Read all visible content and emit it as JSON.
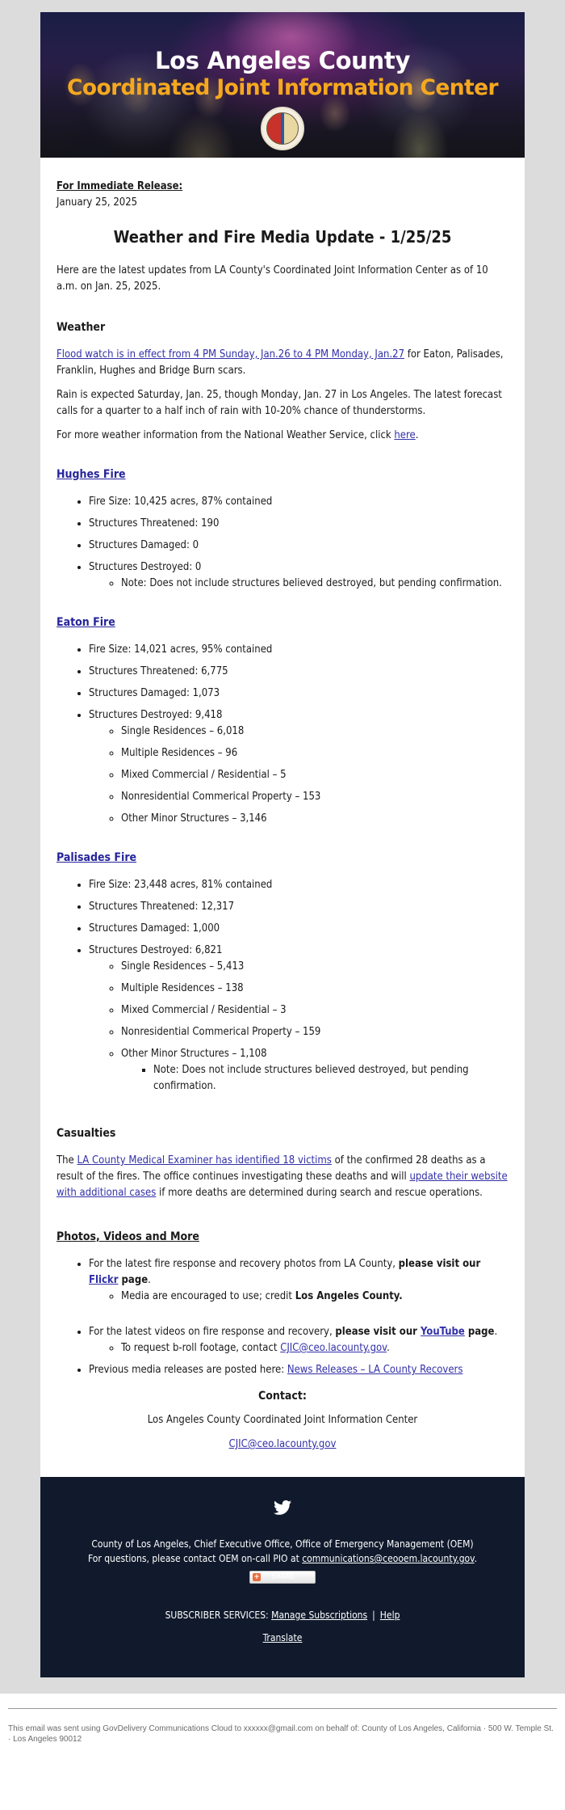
{
  "header": {
    "title_line1": "Los Angeles County",
    "title_line2": "Coordinated Joint Information Center",
    "seal": "county-seal-icon"
  },
  "release": {
    "label": "For Immediate Release:",
    "date": "January 25, 2025"
  },
  "main_title": "Weather and Fire Media Update - 1/25/25",
  "intro": "Here are the latest updates from LA County's Coordinated Joint Information Center as of 10 a.m. on Jan. 25, 2025.",
  "weather": {
    "heading": "Weather",
    "flood_link": "Flood watch is in effect from 4 PM Sunday, Jan.26 to 4 PM Monday, Jan.27",
    "flood_rest": " for Eaton, Palisades, Franklin, Hughes and Bridge Burn scars.",
    "rain": "Rain is expected Saturday, Jan. 25, though Monday, Jan. 27 in Los Angeles. The latest forecast calls for a quarter to a half inch of rain with 10-20% chance of thunderstorms.",
    "nws_prefix": "For more weather information from the National Weather Service, click ",
    "nws_link": "here",
    "nws_suffix": "."
  },
  "fires": [
    {
      "name": "Hughes Fire",
      "stats": [
        "Fire Size: 10,425 acres, 87% contained",
        "Structures Threatened: 190",
        "Structures Damaged: 0",
        "Structures Destroyed: 0"
      ],
      "destroyed_note": "Note: Does not include structures believed destroyed, but pending confirmation."
    },
    {
      "name": "Eaton Fire",
      "stats": [
        "Fire Size: 14,021 acres, 95% contained",
        "Structures Threatened: 6,775",
        "Structures Damaged: 1,073",
        "Structures Destroyed: 9,418"
      ],
      "breakdown": [
        "Single Residences – 6,018",
        "Multiple Residences – 96",
        "Mixed Commercial / Residential – 5",
        "Nonresidential Commerical Property – 153",
        "Other Minor Structures – 3,146"
      ]
    },
    {
      "name": "Palisades Fire",
      "stats": [
        "Fire Size: 23,448 acres, 81% contained",
        "Structures Threatened: 12,317",
        "Structures Damaged: 1,000",
        "Structures Destroyed: 6,821"
      ],
      "breakdown": [
        "Single Residences – 5,413",
        "Multiple Residences – 138",
        "Mixed Commercial / Residential – 3",
        "Nonresidential Commerical Property – 159",
        "Other Minor Structures – 1,108"
      ],
      "breakdown_note": "Note: Does not include structures believed destroyed, but pending confirmation."
    }
  ],
  "casualties": {
    "heading": "Casualties",
    "prefix": "The ",
    "link1": "LA County Medical Examiner has identified 18 victims",
    "middle": " of the confirmed 28 deaths as a result of the fires. The office continues investigating these deaths and will ",
    "link2": "update their website with additional cases",
    "suffix": " if more deaths are determined during search and rescue operations."
  },
  "media": {
    "heading": "Photos, Videos and More",
    "photos_text": "For the latest fire response and recovery photos from LA County, ",
    "photos_bold": "please visit our ",
    "photos_link": "Flickr",
    "photos_bold_end": " page",
    "photos_end": ".",
    "photos_sub_text": "Media are encouraged to use; credit ",
    "photos_sub_bold": "Los Angeles County.",
    "videos_text": "For the latest videos on fire response and recovery, ",
    "videos_bold": "please visit our ",
    "videos_link": "YouTube",
    "videos_bold_end": " page",
    "videos_end": ".",
    "videos_sub_text": "To request b-roll footage, contact ",
    "videos_sub_link": "CJIC@ceo.lacounty.gov",
    "videos_sub_end": ".",
    "previous_text": "Previous media releases are posted here: ",
    "previous_link": "News Releases – LA County Recovers"
  },
  "contact": {
    "heading": "Contact:",
    "org": "Los Angeles County Coordinated Joint Information Center",
    "email": "CJIC@ceo.lacounty.gov"
  },
  "footer": {
    "social_icon": "twitter-icon",
    "org_line": "County of Los Angeles, Chief Executive Office, Office of Emergency Management (OEM)",
    "questions_prefix": "For questions, please contact OEM on-call PIO at ",
    "questions_email": "communications@ceooem.lacounty.gov",
    "questions_suffix": ".",
    "share_label": "SHARE",
    "subscriber_label": "SUBSCRIBER SERVICES: ",
    "manage_link": "Manage Subscriptions",
    "separator": "|",
    "help_link": "Help",
    "translate_link": "Translate",
    "bg_color": "#101a2c"
  },
  "disclaimer": "This email was sent using GovDelivery Communications Cloud to xxxxxx@gmail.com on behalf of: County of Los Angeles, California · 500 W. Temple St. · Los Angeles 90012"
}
